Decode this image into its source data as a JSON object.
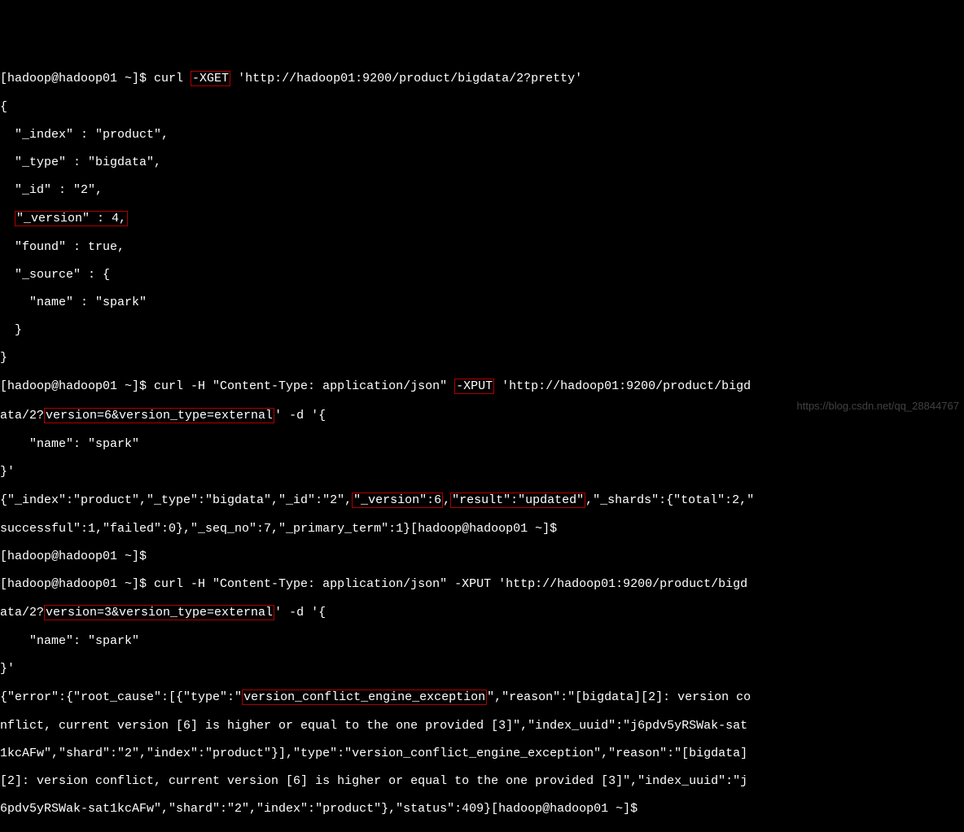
{
  "prompt1": "[hadoop@hadoop01 ~]$ curl ",
  "flag_xget": "-XGET",
  "url1": " 'http://hadoop01:9200/product/bigdata/2?pretty'",
  "resp1_open": "{",
  "resp1_index": "  \"_index\" : \"product\",",
  "resp1_type": "  \"_type\" : \"bigdata\",",
  "resp1_id": "  \"_id\" : \"2\",",
  "resp1_version_pre": "  ",
  "resp1_version_box": "\"_version\" : 4,",
  "resp1_found": "  \"found\" : true,",
  "resp1_source": "  \"_source\" : {",
  "resp1_name": "    \"name\" : \"spark\"",
  "resp1_close_inner": "  }",
  "resp1_close": "}",
  "prompt2_a": "[hadoop@hadoop01 ~]$ curl -H \"Content-Type: application/json\" ",
  "flag_xput": "-XPUT",
  "prompt2_b": " 'http://hadoop01:9200/product/bigd",
  "prompt2_c": "ata/2?",
  "version6_box": "version=6&version_type=external",
  "prompt2_d": "' -d '{",
  "body2_name": "    \"name\": \"spark\"",
  "body2_close": "}'",
  "resp2_a": "{\"_index\":\"product\",\"_type\":\"bigdata\",\"_id\":\"2\",",
  "resp2_version_box": "\"_version\":6",
  "resp2_comma": ",",
  "resp2_result_box": "\"result\":\"updated\"",
  "resp2_b": ",\"_shards\":{\"total\":2,\"",
  "resp2_c": "successful\":1,\"failed\":0},\"_seq_no\":7,\"_primary_term\":1}[hadoop@hadoop01 ~]$",
  "prompt_empty": "[hadoop@hadoop01 ~]$",
  "prompt3_a": "[hadoop@hadoop01 ~]$ curl -H \"Content-Type: application/json\" -XPUT 'http://hadoop01:9200/product/bigd",
  "prompt3_b": "ata/2?",
  "version3_box": "version=3&version_type=external",
  "prompt3_c": "' -d '{",
  "body3_name": "    \"name\": \"spark\"",
  "body3_close": "}'",
  "err_a": "{\"error\":{\"root_cause\":[{\"type\":\"",
  "err_type_box": "version_conflict_engine_exception",
  "err_b": "\",\"reason\":\"[bigdata][2]: version co",
  "err_c": "nflict, current version [6] is higher or equal to the one provided [3]\",\"index_uuid\":\"j6pdv5yRSWak-sat",
  "err_d": "1kcAFw\",\"shard\":\"2\",\"index\":\"product\"}],\"type\":\"version_conflict_engine_exception\",\"reason\":\"[bigdata]",
  "err_e": "[2]: version conflict, current version [6] is higher or equal to the one provided [3]\",\"index_uuid\":\"j",
  "err_f": "6pdv5yRSWak-sat1kcAFw\",\"shard\":\"2\",\"index\":\"product\"},\"status\":409}[hadoop@hadoop01 ~]$ ",
  "watermark": "https://blog.csdn.net/qq_28844767"
}
